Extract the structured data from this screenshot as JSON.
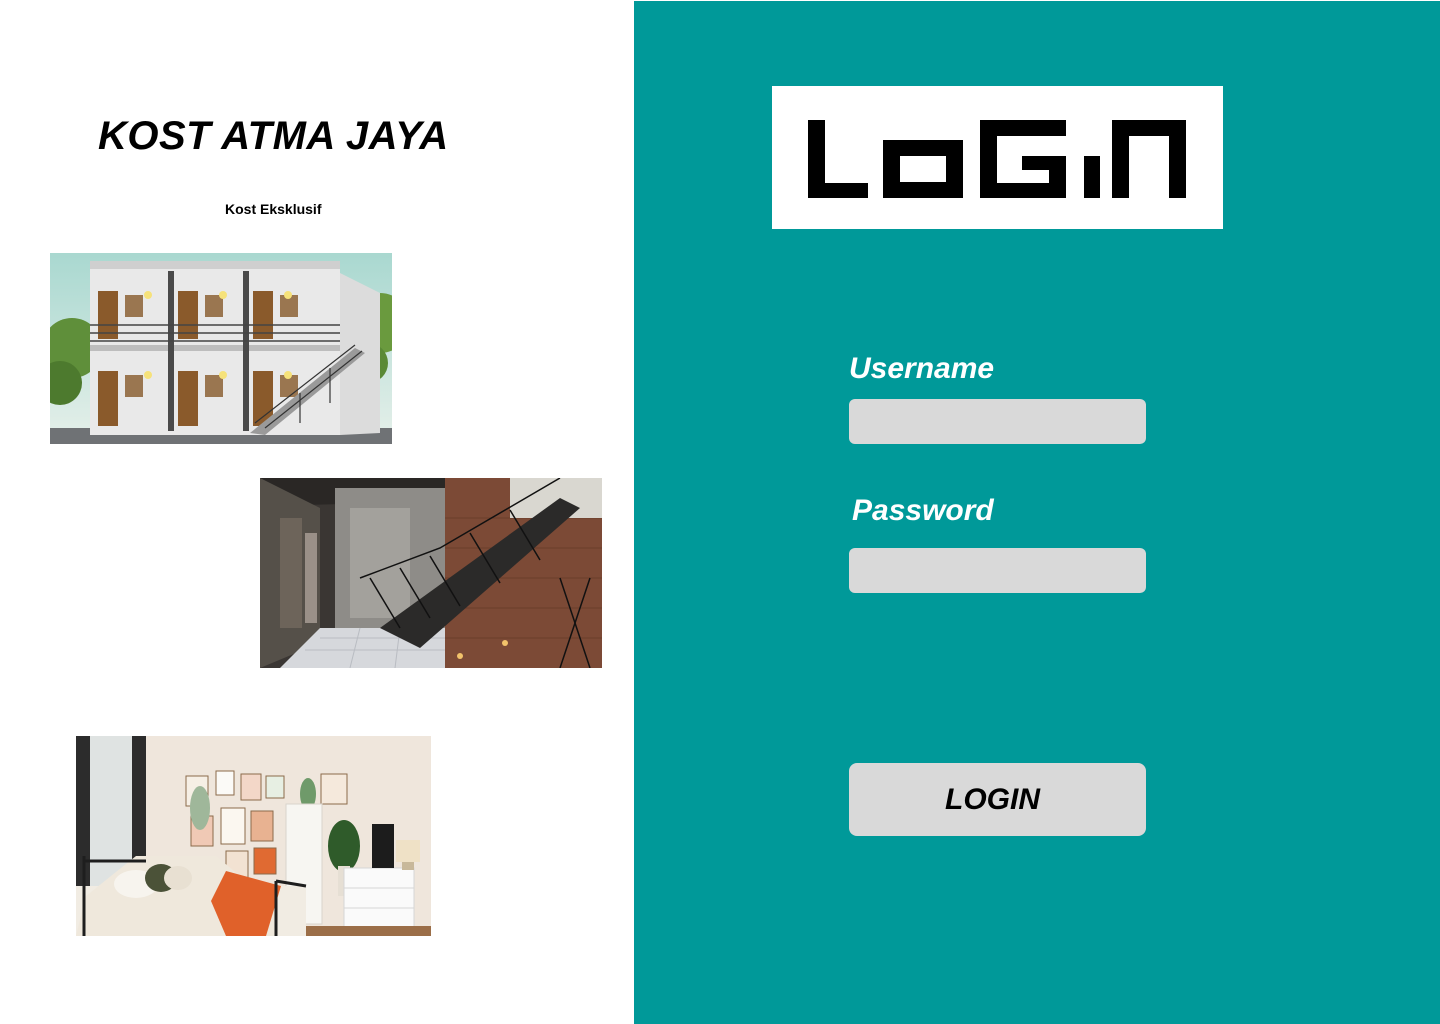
{
  "brand": {
    "title": "KOST ATMA JAYA",
    "subtitle": "Kost Eksklusif"
  },
  "gallery": [
    {
      "subject": "two-story boarding house exterior"
    },
    {
      "subject": "hallway with staircase"
    },
    {
      "subject": "bedroom interior"
    }
  ],
  "login_panel": {
    "logo_text": "LOGIN",
    "background_color": "#009999",
    "username_label": "Username",
    "username_value": "",
    "password_label": "Password",
    "password_value": "",
    "submit_label": "LOGIN"
  }
}
